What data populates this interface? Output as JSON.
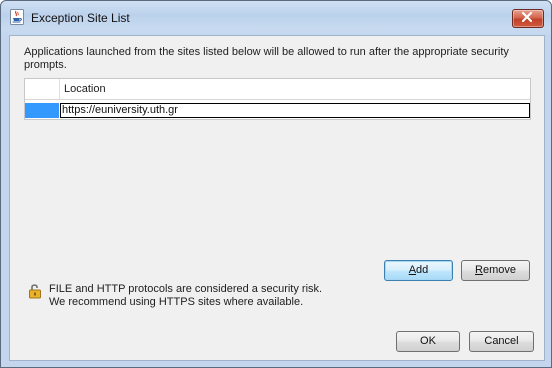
{
  "window": {
    "title": "Exception Site List",
    "icon": "java-coffee-cup-icon"
  },
  "description": "Applications launched from the sites listed below will be allowed to run after the appropriate security prompts.",
  "table": {
    "column_header": "Location",
    "rows": [
      {
        "location": "https://euniversity.uth.gr",
        "selected": true,
        "editing": true
      }
    ]
  },
  "buttons": {
    "add_prefix": "",
    "add_mnemonic": "A",
    "add_suffix": "dd",
    "remove_prefix": "",
    "remove_mnemonic": "R",
    "remove_suffix": "emove",
    "ok": "OK",
    "cancel": "Cancel"
  },
  "warning": {
    "icon": "unlocked-padlock-icon",
    "line1": "FILE and HTTP protocols are considered a security risk.",
    "line2": "We recommend using HTTPS sites where available."
  },
  "colors": {
    "selection": "#3399ff",
    "close_button": "#c7432b",
    "focus_border": "#3c7fb1"
  }
}
